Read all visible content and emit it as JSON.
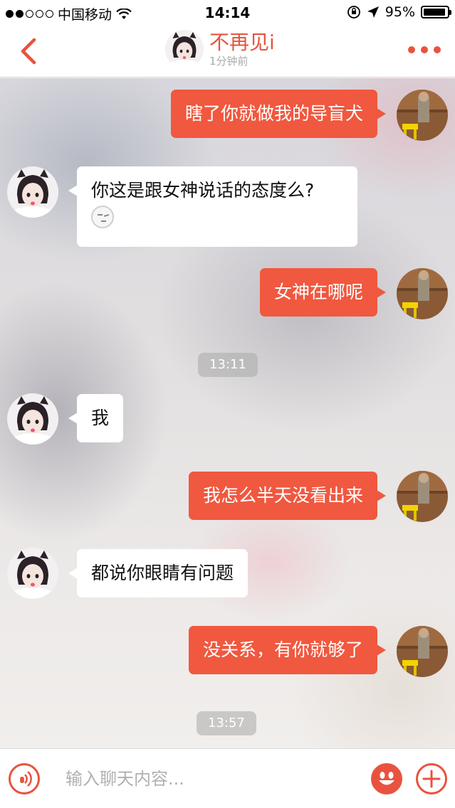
{
  "status_bar": {
    "carrier": "中国移动",
    "time": "14:14",
    "battery_percent": "95%",
    "battery_level": 0.95,
    "signal_bars_filled": 2,
    "signal_bars_total": 5
  },
  "header": {
    "contact_name": "不再见i",
    "last_seen": "1分钟前",
    "accent_color": "#e8533f"
  },
  "messages": [
    {
      "sender": "self",
      "text": "瞎了你就做我的导盲犬"
    },
    {
      "sender": "other",
      "text": "你这是跟女神说话的态度么?",
      "emoji": "awkward-face"
    },
    {
      "sender": "self",
      "text": "女神在哪呢"
    },
    {
      "type": "timestamp",
      "text": "13:11"
    },
    {
      "sender": "other",
      "text": "我"
    },
    {
      "sender": "self",
      "text": "我怎么半天没看出来"
    },
    {
      "sender": "other",
      "text": "都说你眼睛有问题"
    },
    {
      "sender": "self",
      "text": "没关系，有你就够了"
    },
    {
      "type": "timestamp",
      "text": "13:57"
    }
  ],
  "input_bar": {
    "placeholder": "输入聊天内容...",
    "value": ""
  },
  "colors": {
    "self_bubble": "#f0583f",
    "other_bubble": "#ffffff",
    "accent": "#e8533f"
  }
}
